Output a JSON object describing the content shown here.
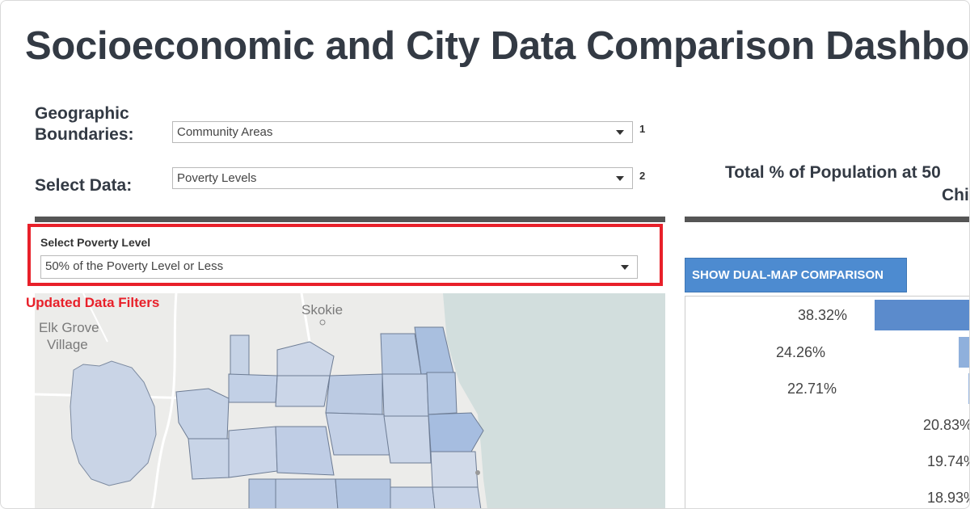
{
  "title": "Socioeconomic and City Data Comparison Dashboa",
  "controls": {
    "geo_label_line1": "Geographic",
    "geo_label_line2": "Boundaries:",
    "geo_value": "Community Areas",
    "geo_step": "1",
    "data_label": "Select Data:",
    "data_value": "Poverty Levels",
    "data_step": "2"
  },
  "filter": {
    "label": "Select Poverty Level",
    "value": "50% of the Poverty Level or Less",
    "callout": "Updated Data Filters"
  },
  "map": {
    "places": [
      "Skokie",
      "Elk Grove",
      "Village"
    ]
  },
  "chart": {
    "title_line1": "Total % of Population at 50",
    "title_line2": "Chi",
    "dual_map_button": "SHOW DUAL-MAP COMPARISON",
    "values": [
      "38.32%",
      "24.26%",
      "22.71%",
      "20.83%",
      "19.74%",
      "18.93%"
    ],
    "fractions": [
      1.0,
      0.63,
      0.59,
      0.54,
      0.52,
      0.49
    ]
  },
  "colors": {
    "highlight": "#e8202a",
    "button": "#4d8bd0",
    "bar_dark": "#4a7fc5",
    "bar_light": "#8fb0dc"
  }
}
